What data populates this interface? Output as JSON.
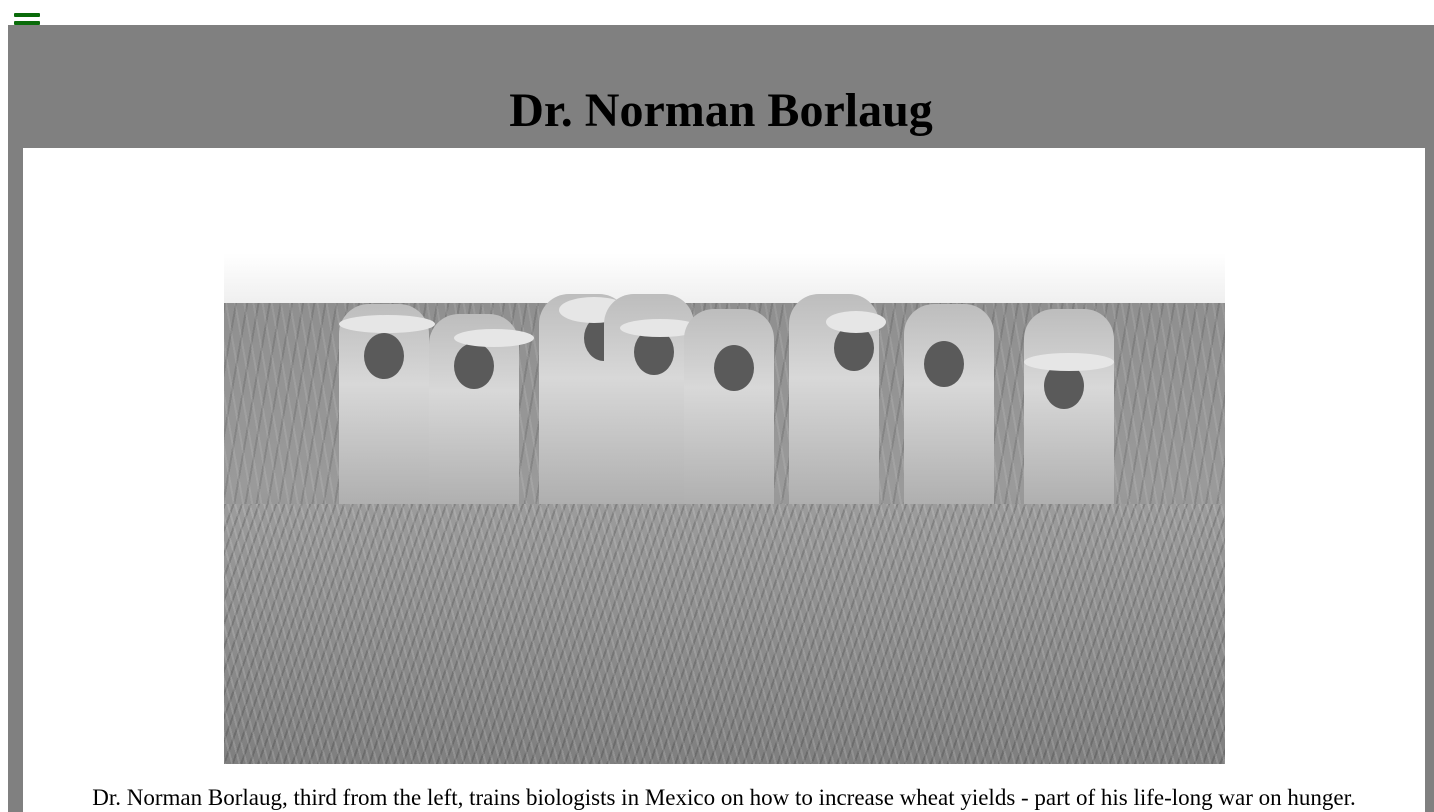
{
  "menu": {
    "icon": "hamburger-menu-icon",
    "color": "#0a6b0a"
  },
  "page": {
    "title": "Dr. Norman Borlaug",
    "background_color": "#808080"
  },
  "figure": {
    "image_description_icon": "photo",
    "caption": "Dr. Norman Borlaug, third from the left, trains biologists in Mexico on how to increase wheat yields - part of his life-long war on hunger."
  }
}
